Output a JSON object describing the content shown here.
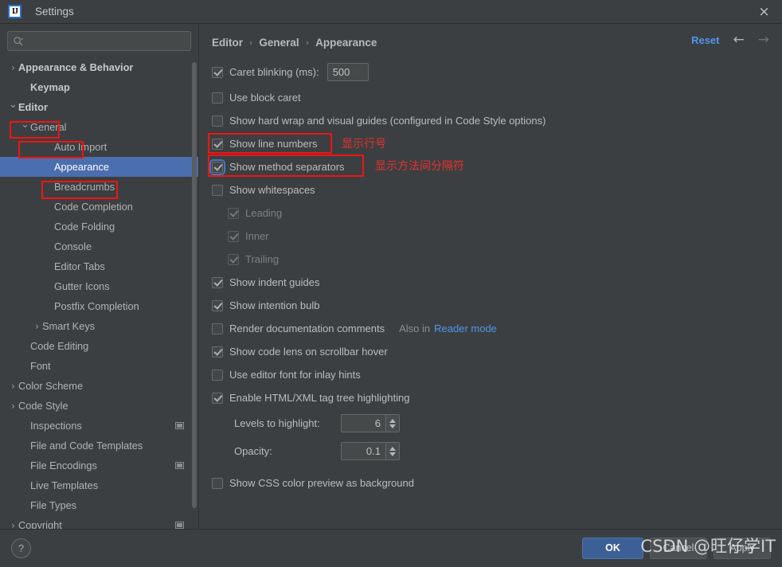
{
  "window": {
    "title": "Settings",
    "logo_text": "IJ",
    "close_icon": "×"
  },
  "sidebar": {
    "search": {
      "value": "",
      "placeholder": ""
    },
    "items": [
      {
        "label": "Appearance & Behavior",
        "arrow": "›",
        "indent": 0,
        "bold": true,
        "selected": false,
        "project_icon": false
      },
      {
        "label": "Keymap",
        "arrow": "",
        "indent": 1,
        "bold": true,
        "selected": false,
        "project_icon": false
      },
      {
        "label": "Editor",
        "arrow": "⌄",
        "indent": 0,
        "bold": true,
        "selected": false,
        "project_icon": false
      },
      {
        "label": "General",
        "arrow": "⌄",
        "indent": 1,
        "bold": false,
        "selected": false,
        "project_icon": false
      },
      {
        "label": "Auto Import",
        "arrow": "",
        "indent": 3,
        "bold": false,
        "selected": false,
        "project_icon": false
      },
      {
        "label": "Appearance",
        "arrow": "",
        "indent": 3,
        "bold": false,
        "selected": true,
        "project_icon": false
      },
      {
        "label": "Breadcrumbs",
        "arrow": "",
        "indent": 3,
        "bold": false,
        "selected": false,
        "project_icon": false
      },
      {
        "label": "Code Completion",
        "arrow": "",
        "indent": 3,
        "bold": false,
        "selected": false,
        "project_icon": false
      },
      {
        "label": "Code Folding",
        "arrow": "",
        "indent": 3,
        "bold": false,
        "selected": false,
        "project_icon": false
      },
      {
        "label": "Console",
        "arrow": "",
        "indent": 3,
        "bold": false,
        "selected": false,
        "project_icon": false
      },
      {
        "label": "Editor Tabs",
        "arrow": "",
        "indent": 3,
        "bold": false,
        "selected": false,
        "project_icon": false
      },
      {
        "label": "Gutter Icons",
        "arrow": "",
        "indent": 3,
        "bold": false,
        "selected": false,
        "project_icon": false
      },
      {
        "label": "Postfix Completion",
        "arrow": "",
        "indent": 3,
        "bold": false,
        "selected": false,
        "project_icon": false
      },
      {
        "label": "Smart Keys",
        "arrow": "›",
        "indent": 2,
        "bold": false,
        "selected": false,
        "project_icon": false
      },
      {
        "label": "Code Editing",
        "arrow": "",
        "indent": 1,
        "bold": false,
        "selected": false,
        "project_icon": false
      },
      {
        "label": "Font",
        "arrow": "",
        "indent": 1,
        "bold": false,
        "selected": false,
        "project_icon": false
      },
      {
        "label": "Color Scheme",
        "arrow": "›",
        "indent": 0,
        "bold": false,
        "selected": false,
        "project_icon": false
      },
      {
        "label": "Code Style",
        "arrow": "›",
        "indent": 0,
        "bold": false,
        "selected": false,
        "project_icon": false
      },
      {
        "label": "Inspections",
        "arrow": "",
        "indent": 1,
        "bold": false,
        "selected": false,
        "project_icon": true
      },
      {
        "label": "File and Code Templates",
        "arrow": "",
        "indent": 1,
        "bold": false,
        "selected": false,
        "project_icon": false
      },
      {
        "label": "File Encodings",
        "arrow": "",
        "indent": 1,
        "bold": false,
        "selected": false,
        "project_icon": true
      },
      {
        "label": "Live Templates",
        "arrow": "",
        "indent": 1,
        "bold": false,
        "selected": false,
        "project_icon": false
      },
      {
        "label": "File Types",
        "arrow": "",
        "indent": 1,
        "bold": false,
        "selected": false,
        "project_icon": false
      },
      {
        "label": "Copyright",
        "arrow": "›",
        "indent": 0,
        "bold": false,
        "selected": false,
        "project_icon": true
      }
    ]
  },
  "header": {
    "breadcrumb": [
      "Editor",
      "General",
      "Appearance"
    ],
    "separator": "›",
    "reset_label": "Reset",
    "back_icon": "←",
    "forward_icon": "→"
  },
  "options": {
    "caret_blinking": {
      "label": "Caret blinking (ms):",
      "checked": true,
      "value": "500"
    },
    "use_block_caret": {
      "label": "Use block caret",
      "checked": false
    },
    "show_hard_wrap": {
      "label": "Show hard wrap and visual guides (configured in Code Style options)",
      "checked": false
    },
    "show_line_numbers": {
      "label": "Show line numbers",
      "checked": true
    },
    "show_method_separators": {
      "label": "Show method separators",
      "checked": true
    },
    "show_whitespaces": {
      "label": "Show whitespaces",
      "checked": false
    },
    "leading": {
      "label": "Leading",
      "checked": true,
      "disabled": true
    },
    "inner": {
      "label": "Inner",
      "checked": true,
      "disabled": true
    },
    "trailing": {
      "label": "Trailing",
      "checked": true,
      "disabled": true
    },
    "show_indent_guides": {
      "label": "Show indent guides",
      "checked": true
    },
    "show_intention_bulb": {
      "label": "Show intention bulb",
      "checked": true
    },
    "render_doc_comments": {
      "label": "Render documentation comments",
      "checked": false,
      "note_prefix": "Also in",
      "note_link": "Reader mode"
    },
    "show_code_lens": {
      "label": "Show code lens on scrollbar hover",
      "checked": true
    },
    "use_editor_font_inlay": {
      "label": "Use editor font for inlay hints",
      "checked": false
    },
    "enable_tag_tree": {
      "label": "Enable HTML/XML tag tree highlighting",
      "checked": true
    },
    "levels_to_highlight": {
      "label": "Levels to highlight:",
      "value": "6"
    },
    "opacity": {
      "label": "Opacity:",
      "value": "0.1"
    },
    "show_css_color_preview": {
      "label": "Show CSS color preview as background",
      "checked": false
    }
  },
  "annotations": {
    "line_numbers_cn": "显示行号",
    "method_separators_cn": "显示方法间分隔符",
    "highlight_color": "#f01414"
  },
  "footer": {
    "help_icon": "?",
    "ok_label": "OK",
    "cancel_label": "Cancel",
    "apply_label": "Apply"
  },
  "watermark": {
    "text": "CSDN @旺仔学IT"
  }
}
